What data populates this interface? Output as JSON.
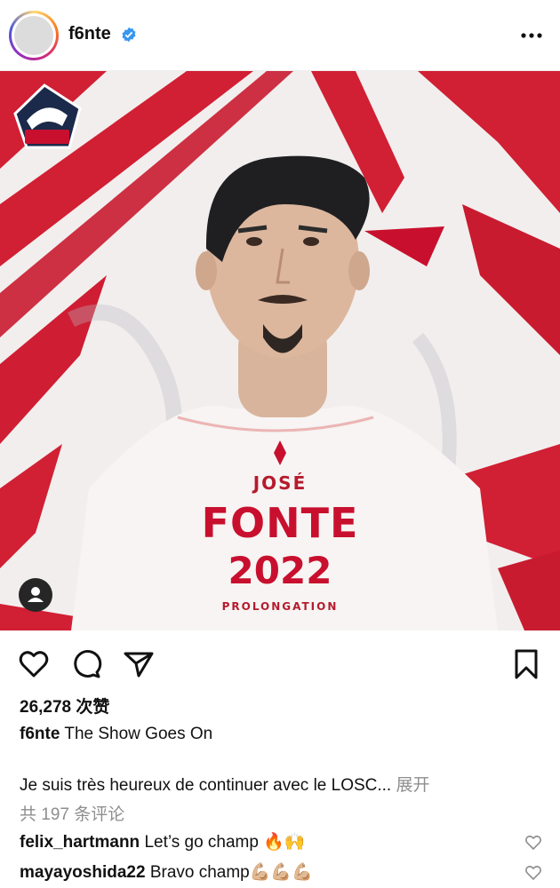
{
  "post": {
    "username": "f6nte",
    "verified_icon": "verified-badge-icon",
    "more_icon": "more-dots-icon",
    "image": {
      "club_badge": "LOSC",
      "first_name": "JOSÉ",
      "last_name": "FONTE",
      "year": "2022",
      "subtitle": "PROLONGATION",
      "tag_icon": "person-tag-icon"
    },
    "actions": [
      "heart-icon",
      "comment-icon",
      "share-icon",
      "bookmark-icon"
    ],
    "likes": "26,278 次赞",
    "caption_user": "f6nte",
    "caption_text": "The Show Goes On",
    "excerpt": "Je suis très heureux de continuer avec le LOSC...",
    "expand_label": "展开",
    "comment_count": "共 197 条评论",
    "comments": [
      {
        "user": "felix_hartmann",
        "text": "Let’s go champ 🔥🙌"
      },
      {
        "user": "mayayoshida22",
        "text": "Bravo champ💪🏼💪🏼💪🏼"
      }
    ]
  },
  "colors": {
    "accent_red": "#c8102e",
    "verified_blue": "#3897f0",
    "muted": "#8e8e8e"
  }
}
